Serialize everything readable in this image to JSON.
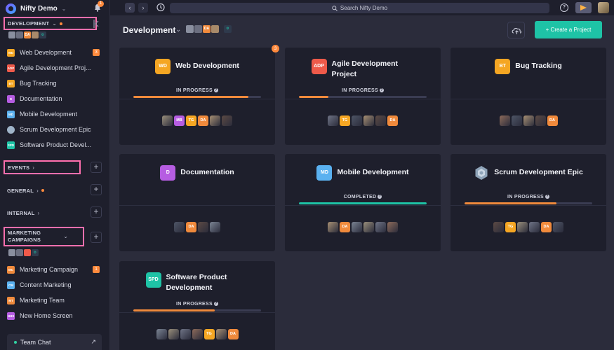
{
  "app": {
    "name": "Nifty Demo",
    "notification_count": "1",
    "search_placeholder": "Search Nifty Demo"
  },
  "colors": {
    "accent": "#1ec3a6",
    "badge": "#ff8a3d",
    "highlight": "#ff6fae",
    "progress_orange": "#f08a3c",
    "progress_teal": "#1ec3a6"
  },
  "sidebar": {
    "development_label": "DEVELOPMENT",
    "development_items": [
      {
        "code": "WD",
        "label": "Web Development",
        "color": "#f5a623",
        "badge": "3"
      },
      {
        "code": "ADP",
        "label": "Agile Development Proj...",
        "color": "#ef5a4a",
        "badge": ""
      },
      {
        "code": "BT",
        "label": "Bug Tracking",
        "color": "#f5a623",
        "badge": ""
      },
      {
        "code": "D",
        "label": "Documentation",
        "color": "#b65de2",
        "badge": ""
      },
      {
        "code": "MD",
        "label": "Mobile Development",
        "color": "#5ab1f0",
        "badge": ""
      },
      {
        "code": "",
        "label": "Scrum Development Epic",
        "color": "#9fb4c9",
        "badge": "",
        "icon": "gear-icon"
      },
      {
        "code": "SPD",
        "label": "Software Product Devel...",
        "color": "#1ec3a6",
        "badge": ""
      }
    ],
    "events_label": "EVENTS",
    "general_label": "GENERAL",
    "internal_label": "INTERNAL",
    "marketing_label_line1": "MARKETING",
    "marketing_label_line2": "CAMPAIGNS",
    "marketing_items": [
      {
        "code": "MC",
        "label": "Marketing Campaign",
        "color": "#f08a3c",
        "badge": "1"
      },
      {
        "code": "CM",
        "label": "Content Marketing",
        "color": "#5ab1f0",
        "badge": ""
      },
      {
        "code": "MT",
        "label": "Marketing Team",
        "color": "#f08a3c",
        "badge": ""
      },
      {
        "code": "NHS",
        "label": "New Home Screen",
        "color": "#b65de2",
        "badge": ""
      }
    ],
    "dev_mini_avatar_code": "DA",
    "team_chat_label": "Team Chat"
  },
  "header": {
    "title": "Development",
    "avatar_code": "DA",
    "create_button": "+ Create a Project"
  },
  "projects": [
    {
      "code": "WD",
      "name": "Web Development",
      "color": "#f5a623",
      "status": "IN PROGRESS",
      "progress": 0.9,
      "badge": "3",
      "members": [
        "",
        "MB",
        "TG",
        "DA",
        "",
        ""
      ]
    },
    {
      "code": "ADP",
      "name": "Agile Development Project",
      "color": "#ef5a4a",
      "status": "IN PROGRESS",
      "progress": 0.23,
      "badge": "",
      "members": [
        "",
        "TG",
        "",
        "",
        "",
        "DA"
      ]
    },
    {
      "code": "BT",
      "name": "Bug Tracking",
      "color": "#f5a623",
      "status": "",
      "progress": null,
      "badge": "",
      "members": [
        "",
        "",
        "",
        "",
        "DA"
      ]
    },
    {
      "code": "D",
      "name": "Documentation",
      "color": "#b65de2",
      "status": "",
      "progress": null,
      "badge": "",
      "members": [
        "",
        "DA",
        "",
        ""
      ]
    },
    {
      "code": "MD",
      "name": "Mobile Development",
      "color": "#5ab1f0",
      "status": "COMPLETED",
      "progress": 1.0,
      "badge": "",
      "members": [
        "",
        "DA",
        "",
        "",
        "",
        ""
      ]
    },
    {
      "code": "",
      "name": "Scrum Development Epic",
      "color": "#9fb4c9",
      "status": "IN PROGRESS",
      "progress": 0.72,
      "badge": "",
      "icon": "gear-icon",
      "members": [
        "",
        "TG",
        "",
        "",
        "DA",
        ""
      ]
    },
    {
      "code": "SPD",
      "name": "Software Product Development",
      "color": "#1ec3a6",
      "status": "IN PROGRESS",
      "progress": 0.64,
      "badge": "",
      "members": [
        "",
        "",
        "",
        "",
        "TG",
        "",
        "DA"
      ]
    }
  ]
}
